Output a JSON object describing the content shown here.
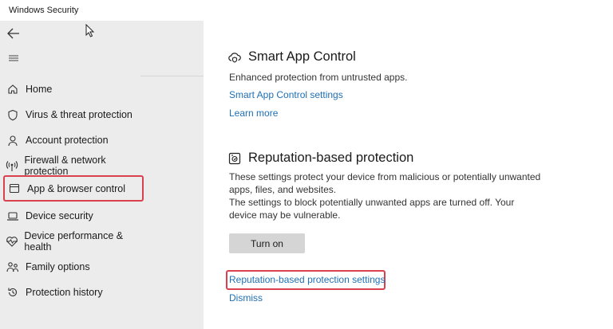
{
  "window": {
    "title": "Windows Security"
  },
  "sidebar": {
    "back_icon": "back-arrow-icon",
    "menu_icon": "hamburger-menu-icon",
    "items": [
      {
        "label": "Home",
        "icon": "home-icon"
      },
      {
        "label": "Virus & threat protection",
        "icon": "shield-icon"
      },
      {
        "label": "Account protection",
        "icon": "person-icon"
      },
      {
        "label": "Firewall & network protection",
        "icon": "antenna-icon"
      },
      {
        "label": "App & browser control",
        "icon": "app-window-icon",
        "selected": true
      },
      {
        "label": "Device security",
        "icon": "laptop-icon"
      },
      {
        "label": "Device performance & health",
        "icon": "heart-pulse-icon"
      },
      {
        "label": "Family options",
        "icon": "family-icon"
      },
      {
        "label": "Protection history",
        "icon": "history-icon"
      }
    ]
  },
  "smart_app_control": {
    "title": "Smart App Control",
    "icon": "cloud-shield-icon",
    "description": "Enhanced protection from untrusted apps.",
    "settings_link": "Smart App Control settings",
    "learn_more": "Learn more"
  },
  "reputation": {
    "title": "Reputation-based protection",
    "icon": "reputation-shield-icon",
    "description_lines": [
      "These settings protect your device from malicious or potentially unwanted",
      "apps, files, and websites.",
      "The settings to block potentially unwanted apps are turned off. Your",
      "device may be vulnerable."
    ],
    "turn_on_button": "Turn on",
    "settings_link": "Reputation-based protection settings",
    "dismiss_link": "Dismiss"
  },
  "colors": {
    "sidebar_bg": "#ececec",
    "link": "#1f6fb5",
    "highlight": "#d9414f",
    "button_bg": "#d5d5d5"
  }
}
